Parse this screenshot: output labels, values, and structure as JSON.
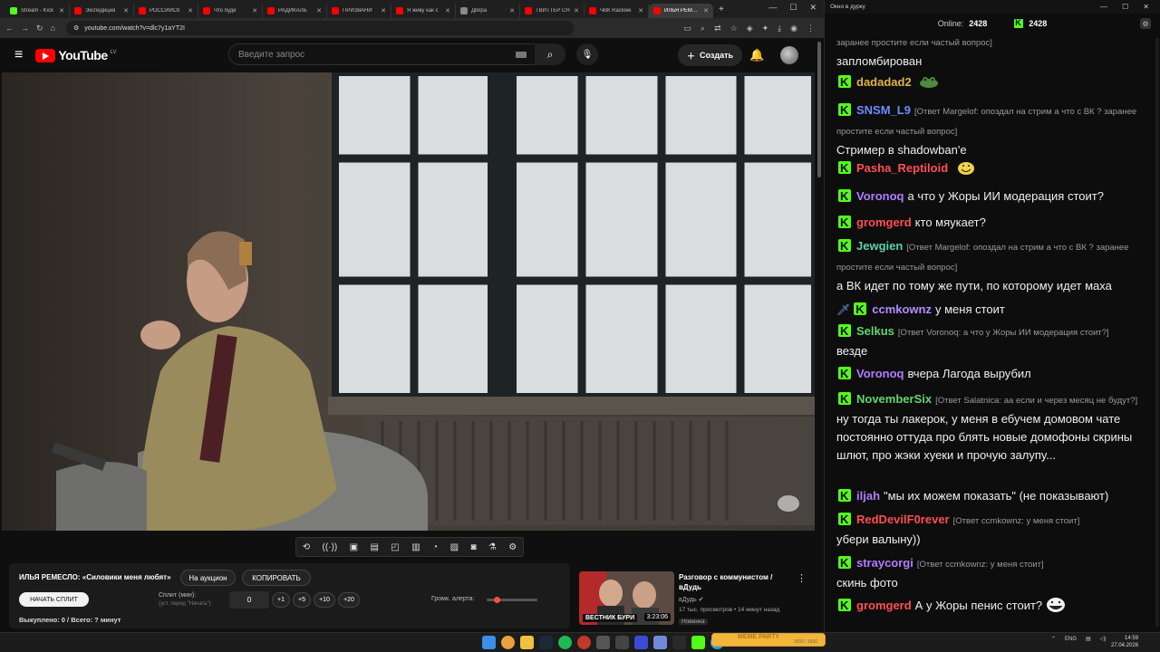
{
  "browser": {
    "tabs": [
      {
        "label": "Stream - Kick",
        "icon": "k"
      },
      {
        "label": "Экспедиция",
        "icon": "yt"
      },
      {
        "label": "РОССИЙСК",
        "icon": "yt"
      },
      {
        "label": "Что буде",
        "icon": "yt"
      },
      {
        "label": "РАДИКАЛЬ",
        "icon": "yt"
      },
      {
        "label": "ПРИЗВАНИ",
        "icon": "yt"
      },
      {
        "label": "Я живу как с",
        "icon": "yt"
      },
      {
        "label": "Дbl/pa",
        "icon": "d"
      },
      {
        "label": "ТВИТТЕР СН",
        "icon": "yt"
      },
      {
        "label": "ЧВК Rackwe",
        "icon": "yt"
      },
      {
        "label": "ИЛЬЯ РЕМЕС",
        "icon": "yt",
        "active": true
      }
    ],
    "url": "youtube.com/watch?v=dlc7y1aYT2I"
  },
  "youtube": {
    "logo_text": "YouTube",
    "region": "LV",
    "search_placeholder": "Введите запрос",
    "create_label": "Создать"
  },
  "split_panel": {
    "title": "ИЛЬЯ РЕМЕСЛО: «Силовики меня любят»",
    "auction_label": "На аукцион",
    "copy_label": "КОПИРОВАТЬ",
    "start_label": "НАЧАТЬ СПЛИТ",
    "split_label": "Сплит (мин):",
    "split_hint": "(уст. перед \"Начать\")",
    "split_value": "0",
    "increments": [
      "+1",
      "+5",
      "+10",
      "+20"
    ],
    "volume_label": "Громк. алерта:",
    "volume_level": 0.2,
    "bought_text": "Выкуплено: 0 / Всего: ? минут"
  },
  "recommendation": {
    "title": "Разговор с коммунистом / вДудь",
    "channel": "вДудь",
    "stats": "17 тыс. просмотров • 14 минут назад",
    "badge": "Новинка",
    "duration": "3:23:06",
    "thumb_brand": "ВЕСТНИК БУРИ"
  },
  "chat": {
    "window_title": "Окно в дурку",
    "online_label": "Online:",
    "online_count": "2428",
    "kick_count": "2428",
    "messages": [
      {
        "user": "",
        "color": "#ffffff",
        "reply": "заранее простите если частый вопрос]",
        "text": "запломбирован"
      },
      {
        "user": "dadadad2",
        "color": "#e0b54a",
        "reply": "",
        "text": "",
        "emote": "frog"
      },
      {
        "user": "SNSM_L9",
        "color": "#6f8cff",
        "reply": "[Ответ Margelof: опоздал на стрим а что с ВК ? заранее простите если частый вопрос]",
        "text": "Стример в shadowban'e"
      },
      {
        "user": "Pasha_Reptiloid",
        "color": "#ff5050",
        "reply": "",
        "text": "",
        "emote": "smile"
      },
      {
        "user": "Voronoq",
        "color": "#b27dff",
        "reply": "",
        "text": "а что у Жоры ИИ модерация стоит?"
      },
      {
        "user": "gromgerd",
        "color": "#ff4f4f",
        "reply": "",
        "text": "кто мяукает?"
      },
      {
        "user": "Jewgien",
        "color": "#5cd1a6",
        "reply": "[Ответ Margelof: опоздал на стрим а что с ВК ? заранее простите если частый вопрос]",
        "text": "а ВК идет по тому же пути, по которому идет маха"
      },
      {
        "user": "ccmkownz",
        "color": "#b58cff",
        "reply": "",
        "text": "у меня стоит",
        "badge": "sword"
      },
      {
        "user": "Selkus",
        "color": "#63d66b",
        "reply": "[Ответ Voronoq: а что у Жоры ИИ модерация стоит?]",
        "text": "везде"
      },
      {
        "user": "Voronoq",
        "color": "#b27dff",
        "reply": "",
        "text": "вчера Лагода вырубил"
      },
      {
        "user": "NovemberSix",
        "color": "#63d66b",
        "reply": "[Ответ Salatnica: аа если и через месяц не будут?]",
        "text": "ну тогда ты лакерок, у меня в ебучем домовом чате постоянно оттуда про блять новые домофоны скрины шлют, про жэки хуеки и прочую залупу..."
      },
      {
        "user": "iljah",
        "color": "#b27dff",
        "reply": "",
        "text": "\"мы их можем показать\" (не показывают)"
      },
      {
        "user": "RedDevilF0rever",
        "color": "#ff4f4f",
        "reply": "[Ответ ccmkownz: у меня стоит]",
        "text": "убери валыну))"
      },
      {
        "user": "straycorgi",
        "color": "#b27dff",
        "reply": "[Ответ ccmkownz: у меня стоит]",
        "text": "скинь фото"
      },
      {
        "user": "gromgerd",
        "color": "#ff4f4f",
        "reply": "",
        "text": "А у Жоры пенис стоит?",
        "emote": "troll"
      }
    ]
  },
  "taskbar": {
    "meme_label": "MEME PARTY",
    "meme_count": "1500 / 1500",
    "meme_progress": 1.0,
    "lang": "ENG",
    "time": "14:59",
    "date": "27.04.2026"
  }
}
